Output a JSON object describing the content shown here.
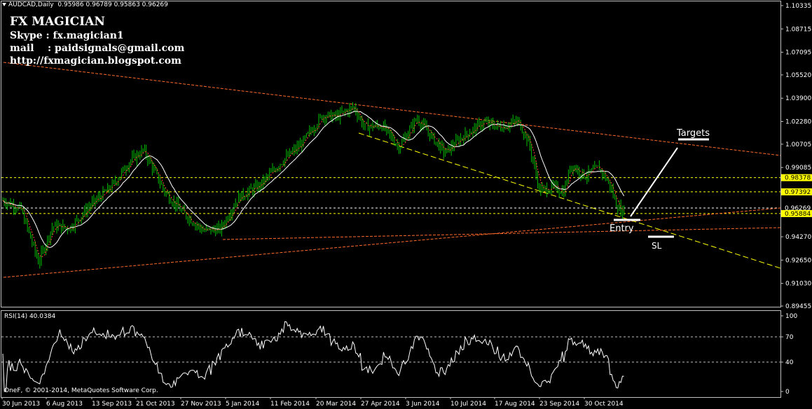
{
  "header": {
    "symbol_label": "AUDCAD,Daily",
    "ohlc": "0.95986 0.96789 0.95863 0.96269"
  },
  "info": {
    "brand": "FX MAGICIAN",
    "skype": "Skype : fx.magician1",
    "mail": "mail    : paidsignals@gmail.com",
    "url": "http://fxmagician.blogspot.com"
  },
  "annotations": {
    "targets": "Targets",
    "entry": "Entry",
    "sl": "SL"
  },
  "price_axis": {
    "ticks": [
      "1.10335",
      "1.08715",
      "1.07095",
      "1.05520",
      "1.03900",
      "1.02280",
      "1.00705",
      "0.99085",
      "0.97392",
      "0.96269",
      "0.95884",
      "0.94270",
      "0.92650",
      "0.91030",
      "0.89455"
    ],
    "levels": [
      {
        "value": "0.98378",
        "color": "#ffff00"
      },
      {
        "value": "0.97392",
        "color": "#ffff00"
      },
      {
        "value": "0.96269",
        "color": "#ffffff"
      },
      {
        "value": "0.95884",
        "color": "#ffff00"
      }
    ]
  },
  "rsi": {
    "label": "RSI(14) 40.0384",
    "ticks": [
      "100",
      "70",
      "40",
      "0"
    ]
  },
  "copyright": "OneF, © 2001-2014, MetaQuotes Software Corp.",
  "time_axis": [
    "30 Jun 2013",
    "6 Aug 2013",
    "13 Sep 2013",
    "21 Oct 2013",
    "27 Nov 2013",
    "5 Jan 2014",
    "11 Feb 2014",
    "20 Mar 2014",
    "27 Apr 2014",
    "3 Jun 2014",
    "10 Jul 2014",
    "17 Aug 2014",
    "23 Sep 2014",
    "30 Oct 2014"
  ],
  "colors": {
    "candle": "#00c000",
    "trendline": "#ff6a2a",
    "level": "#ffff00",
    "ma": "#ffffff",
    "ma_fast": "#ff3b3b"
  }
}
